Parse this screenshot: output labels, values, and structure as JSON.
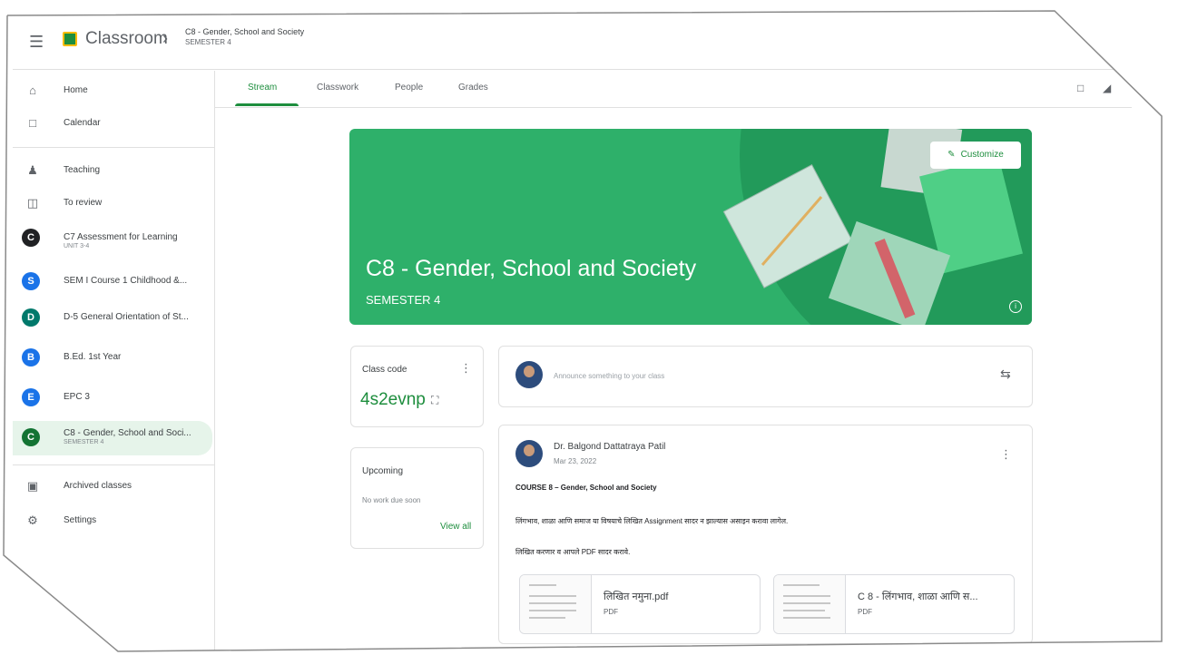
{
  "app": {
    "title": "Classroom"
  },
  "breadcrumb": {
    "title": "C8 - Gender, School and Society",
    "subtitle": "SEMESTER 4"
  },
  "sidebar": {
    "items": [
      {
        "label": "Home",
        "icon": "home-icon"
      },
      {
        "label": "Calendar",
        "icon": "calendar-icon"
      },
      {
        "label": "Teaching",
        "icon": "people-icon"
      },
      {
        "label": "To review",
        "icon": "folder-icon"
      }
    ],
    "classes": [
      {
        "letter": "C",
        "color": "#202124",
        "label": "C7 Assessment for Learning",
        "sub": "UNIT 3-4"
      },
      {
        "letter": "S",
        "color": "#1a73e8",
        "label": "SEM I Course 1 Childhood &...",
        "sub": ""
      },
      {
        "letter": "D",
        "color": "#00796b",
        "label": "D-5 General Orientation of St...",
        "sub": ""
      },
      {
        "letter": "B",
        "color": "#1a73e8",
        "label": "B.Ed. 1st Year",
        "sub": ""
      },
      {
        "letter": "E",
        "color": "#1a73e8",
        "label": "EPC 3",
        "sub": ""
      },
      {
        "letter": "C",
        "color": "#137333",
        "label": "C8 - Gender, School and Soci...",
        "sub": "SEMESTER 4"
      }
    ],
    "footer": [
      {
        "label": "Archived classes",
        "icon": "archive-icon"
      },
      {
        "label": "Settings",
        "icon": "settings-icon"
      }
    ]
  },
  "tabs": [
    {
      "label": "Stream"
    },
    {
      "label": "Classwork"
    },
    {
      "label": "People"
    },
    {
      "label": "Grades"
    }
  ],
  "banner": {
    "title": "C8 - Gender, School and Society",
    "subtitle": "SEMESTER 4",
    "customize_label": "Customize",
    "color": "#2eb06a"
  },
  "class_code": {
    "label": "Class code",
    "code": "4s2evnp"
  },
  "upcoming": {
    "label": "Upcoming",
    "text": "No work due soon",
    "link": "View all"
  },
  "announce": {
    "placeholder": "Announce something to your class"
  },
  "post": {
    "author": "Dr. Balgond Dattatraya Patil",
    "date": "Mar 23, 2022",
    "lines": [
      "COURSE 8 – Gender, School and Society",
      "लिंगभाव, शाळा आणि समाज या विषयाचे लिखित Assignment सादर न झाल्यास असाइन करावा लागेल.",
      "लिखित करणार व आपले PDF सादर करावे."
    ],
    "attachments": [
      {
        "name": "लिखित नमुना.pdf",
        "kind": "PDF"
      },
      {
        "name": "C 8 - लिंगभाव, शाळा आणि स...",
        "kind": "PDF"
      }
    ]
  },
  "colors": {
    "accent": "#1e8e3e",
    "active_bg": "#e6f4ea"
  }
}
